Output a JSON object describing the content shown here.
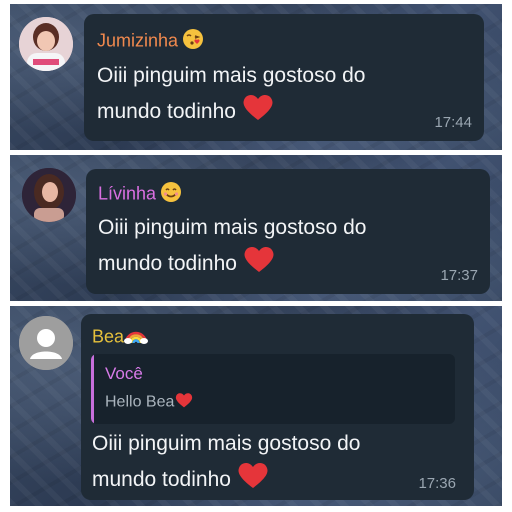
{
  "messages": [
    {
      "sender": "Jumizinha",
      "sender_color": "#f0894e",
      "sender_emoji": "kissing-face-emoji",
      "text": "Oiii pinguim mais gostoso do mundo todinho",
      "trailing_emoji": "red-heart-emoji",
      "time": "17:44",
      "avatar": "user-photo-avatar"
    },
    {
      "sender": "Lívinha",
      "sender_color": "#d86fe0",
      "sender_emoji": "smiling-face-emoji",
      "text": "Oiii pinguim mais gostoso do mundo todinho",
      "trailing_emoji": "red-heart-emoji",
      "time": "17:37",
      "avatar": "user-photo-avatar"
    },
    {
      "sender": "Bea",
      "sender_color": "#e6c13c",
      "sender_emoji": "rainbow-emoji",
      "reply": {
        "author": "Você",
        "text": "Hello Bea",
        "emoji": "red-heart-emoji"
      },
      "text": "Oiii pinguim mais gostoso do mundo todinho",
      "trailing_emoji": "red-heart-emoji",
      "time": "17:36",
      "avatar": "default-person-avatar"
    }
  ],
  "colors": {
    "bubble": "#1f2b36",
    "message_text": "#f2f4f6",
    "timestamp": "#9aa6b1",
    "heart": "#e5353a"
  }
}
